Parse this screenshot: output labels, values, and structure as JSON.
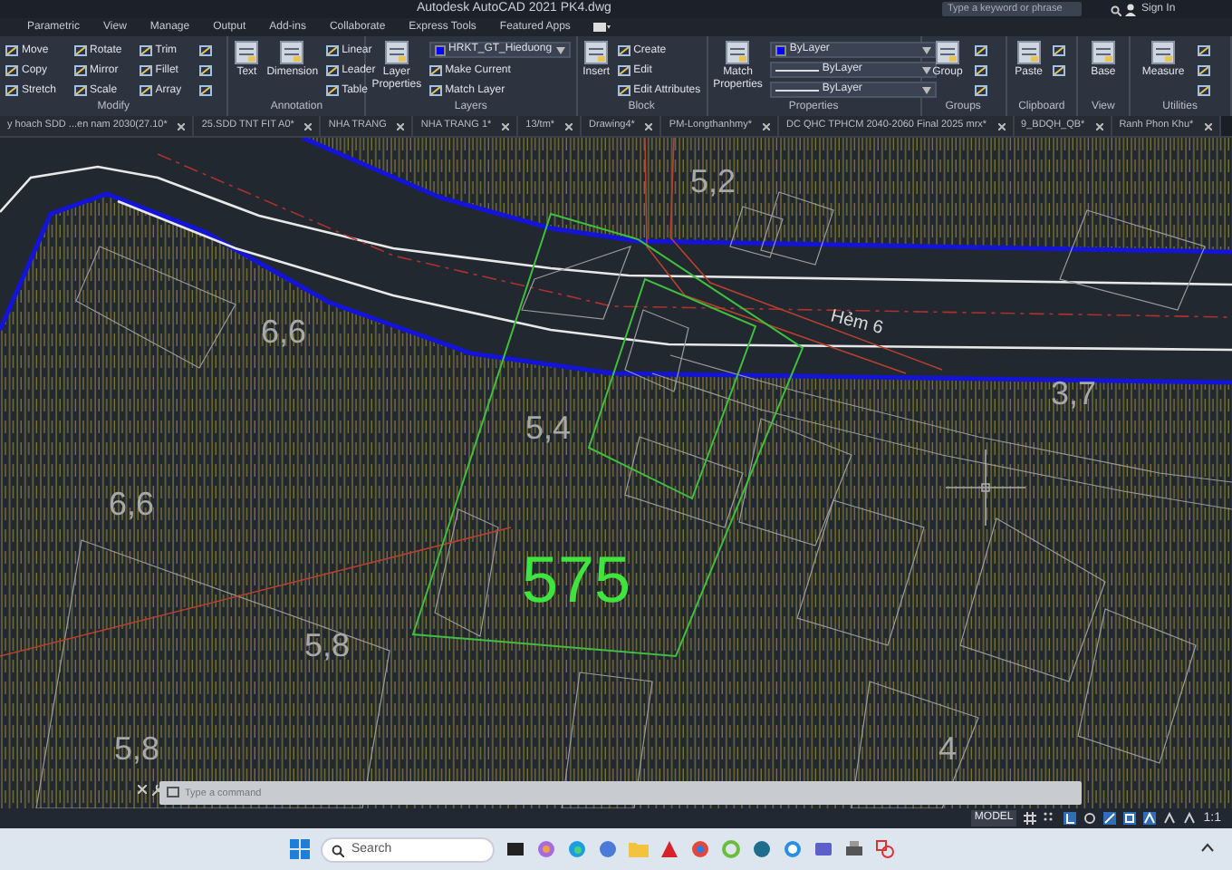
{
  "title_bar": {
    "app": "Autodesk AutoCAD 2021",
    "file": "PK4.dwg",
    "search": {
      "placeholder": "Type a keyword or phrase"
    },
    "sign_in": "Sign In"
  },
  "ribbon_tabs": [
    {
      "label": "Parametric",
      "selected": false
    },
    {
      "label": "View",
      "selected": false
    },
    {
      "label": "Manage",
      "selected": false
    },
    {
      "label": "Output",
      "selected": false
    },
    {
      "label": "Add-ins",
      "selected": false
    },
    {
      "label": "Collaborate",
      "selected": false
    },
    {
      "label": "Express Tools",
      "selected": false
    },
    {
      "label": "Featured Apps",
      "selected": false
    }
  ],
  "ribbon_panels": [
    {
      "title": "Modify",
      "items": [
        {
          "kind": "tool",
          "label": "Move"
        },
        {
          "kind": "tool",
          "label": "Copy"
        },
        {
          "kind": "tool",
          "label": "Stretch"
        },
        {
          "kind": "tool",
          "label": "Rotate"
        },
        {
          "kind": "tool",
          "label": "Mirror"
        },
        {
          "kind": "tool",
          "label": "Scale"
        },
        {
          "kind": "tool",
          "label": "Trim"
        },
        {
          "kind": "tool",
          "label": "Fillet"
        },
        {
          "kind": "tool",
          "label": "Array"
        },
        {
          "kind": "icon"
        },
        {
          "kind": "icon"
        },
        {
          "kind": "icon"
        }
      ]
    },
    {
      "title": "Annotation",
      "items": [
        {
          "kind": "large",
          "label": "Text"
        },
        {
          "kind": "large",
          "label": "Dimension"
        },
        {
          "kind": "tool",
          "label": "Linear"
        },
        {
          "kind": "tool",
          "label": "Leader"
        },
        {
          "kind": "tool",
          "label": "Table"
        }
      ]
    },
    {
      "title": "Layers",
      "items": [
        {
          "kind": "large",
          "label": "Layer Properties"
        },
        {
          "kind": "dropdown",
          "label": "HRKT_GT_Hieduong",
          "color": "#0000ff"
        },
        {
          "kind": "tool",
          "label": "Make Current"
        },
        {
          "kind": "tool",
          "label": "Match Layer"
        }
      ]
    },
    {
      "title": "Block",
      "items": [
        {
          "kind": "large",
          "label": "Insert"
        },
        {
          "kind": "tool",
          "label": "Create"
        },
        {
          "kind": "tool",
          "label": "Edit"
        },
        {
          "kind": "tool",
          "label": "Edit Attributes"
        }
      ]
    },
    {
      "title": "Properties",
      "items": [
        {
          "kind": "large",
          "label": "Match Properties"
        },
        {
          "kind": "dropdown",
          "label": "ByLayer",
          "color": "#0000ff"
        },
        {
          "kind": "dropdown",
          "label": "ByLayer"
        },
        {
          "kind": "dropdown",
          "label": "ByLayer"
        }
      ]
    },
    {
      "title": "Groups",
      "items": [
        {
          "kind": "large",
          "label": "Group"
        },
        {
          "kind": "icon"
        },
        {
          "kind": "icon"
        },
        {
          "kind": "icon"
        }
      ]
    },
    {
      "title": "Clipboard",
      "items": [
        {
          "kind": "large",
          "label": "Paste"
        },
        {
          "kind": "icon"
        },
        {
          "kind": "icon"
        }
      ]
    },
    {
      "title": "View",
      "items": [
        {
          "kind": "large",
          "label": "Base"
        }
      ]
    },
    {
      "title": "Utilities",
      "items": [
        {
          "kind": "large",
          "label": "Measure"
        },
        {
          "kind": "icon"
        },
        {
          "kind": "icon"
        },
        {
          "kind": "icon"
        }
      ]
    }
  ],
  "document_tabs": [
    {
      "label": "y hoach SDD ...en nam 2030(27.10*",
      "selected": false
    },
    {
      "label": "25.SDD TNT FIT A0*",
      "selected": false
    },
    {
      "label": "NHA TRANG",
      "selected": false
    },
    {
      "label": "NHA TRANG 1*",
      "selected": false
    },
    {
      "label": "13/tm*",
      "selected": false
    },
    {
      "label": "Drawing4*",
      "selected": false
    },
    {
      "label": "PM-Longthanhmy*",
      "selected": false
    },
    {
      "label": "DC QHC TPHCM 2040-2060 Final 2025 mrx*",
      "selected": false
    },
    {
      "label": "9_BDQH_QB*",
      "selected": false
    },
    {
      "label": "Ranh Phon Khu*",
      "selected": false
    }
  ],
  "drawing": {
    "labels": [
      {
        "kind": "value",
        "text": "5,2"
      },
      {
        "kind": "value",
        "text": "6,6"
      },
      {
        "kind": "street",
        "text": "Hẻm 6"
      },
      {
        "kind": "value",
        "text": "3,7"
      },
      {
        "kind": "value",
        "text": "5,4"
      },
      {
        "kind": "value",
        "text": "6,6"
      },
      {
        "kind": "parcel",
        "text": "575"
      },
      {
        "kind": "value",
        "text": "5,8"
      },
      {
        "kind": "value",
        "text": "5,8"
      },
      {
        "kind": "value",
        "text": "4"
      }
    ]
  },
  "command_line": {
    "placeholder": "Type a command"
  },
  "status_bar": {
    "mode": "MODEL",
    "scale": "1:1"
  },
  "taskbar": {
    "search": {
      "placeholder": "Search"
    }
  }
}
